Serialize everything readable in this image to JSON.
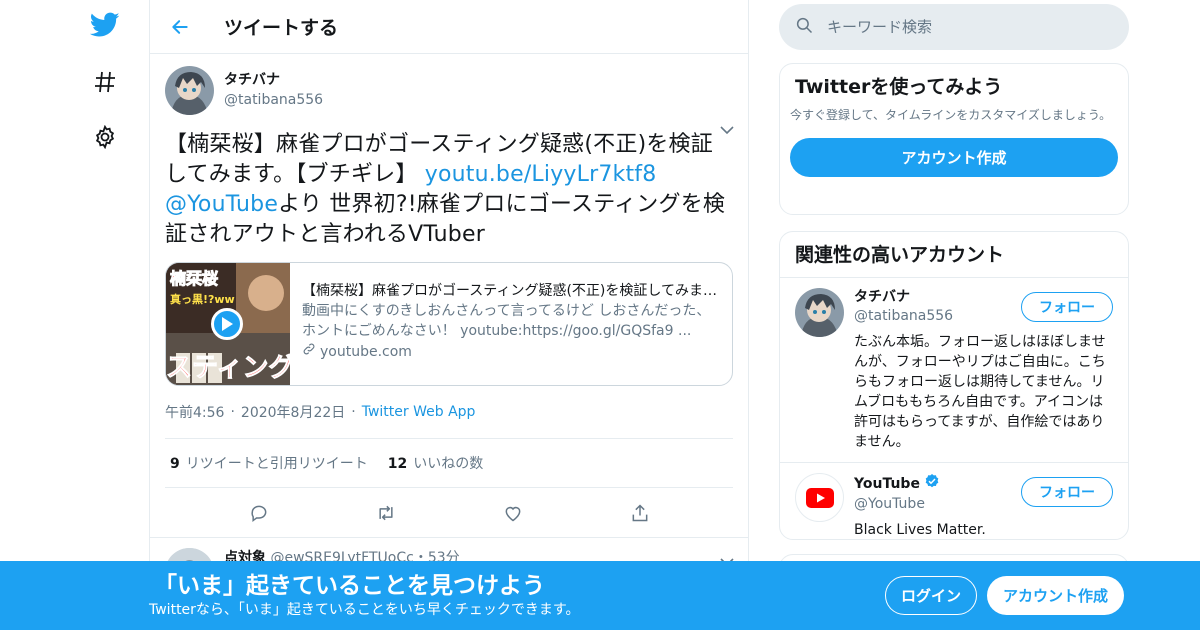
{
  "nav": {
    "icons": [
      "twitter-logo",
      "hashtag-icon",
      "gear-icon"
    ],
    "brand_color": "#1da1f2"
  },
  "header": {
    "title": "ツイートする"
  },
  "tweet": {
    "author_name": "タチバナ",
    "author_handle": "@tatibana556",
    "text_1": "【楠栞桜】麻雀プロがゴースティング疑惑(不正)を検証してみます。【ブチギレ】 ",
    "link": "youtu.be/LiyyLr7ktf8",
    "mention": "@YouTube",
    "text_2": "より 世界初?!麻雀プロにゴースティングを検証されアウトと言われるVTuber",
    "card": {
      "thumb_text_top": "楠栞桜",
      "thumb_text_mid": "真っ黒!?ww",
      "thumb_text_bottom": "スティング",
      "title": "【楠栞桜】麻雀プロがゴースティング疑惑(不正)を検証してみます。【ブチギレ】",
      "description": "動画中にくすのきしおんさんって言ってるけど しおさんだった、ホントにごめんなさい！ youtube:https://goo.gl/GQSfa9 ...",
      "domain": "youtube.com"
    },
    "time": "午前4:56",
    "date": "2020年8月22日",
    "client": "Twitter Web App",
    "retweets_count": "9",
    "retweets_label": "リツイートと引用リツイート",
    "likes_count": "12",
    "likes_label": "いいねの数"
  },
  "reply": {
    "name": "点対象",
    "handle": "@ewSRE9LytFTUoCc",
    "sep": "・",
    "time": "53分"
  },
  "search": {
    "placeholder": "キーワード検索"
  },
  "signup_box": {
    "title": "Twitterを使ってみよう",
    "subtitle": "今すぐ登録して、タイムラインをカスタマイズしましょう。",
    "button": "アカウント作成"
  },
  "related": {
    "title": "関連性の高いアカウント",
    "accounts": [
      {
        "name": "タチバナ",
        "handle": "@tatibana556",
        "bio": "たぶん本垢。フォロー返しはほぼしませんが、フォローやリプはご自由に。こちらもフォロー返しは期待してません。リムブロももちろん自由です。アイコンは許可はもらってますが、自作絵ではありません。",
        "button": "フォロー"
      },
      {
        "name": "YouTube",
        "handle": "@YouTube",
        "bio": "Black Lives Matter.",
        "button": "フォロー",
        "verified": true
      }
    ]
  },
  "banner": {
    "title": "「いま」起きていることを見つけよう",
    "subtitle": "Twitterなら、「いま」起きていることをいち早くチェックできます。",
    "login": "ログイン",
    "signup": "アカウント作成"
  }
}
